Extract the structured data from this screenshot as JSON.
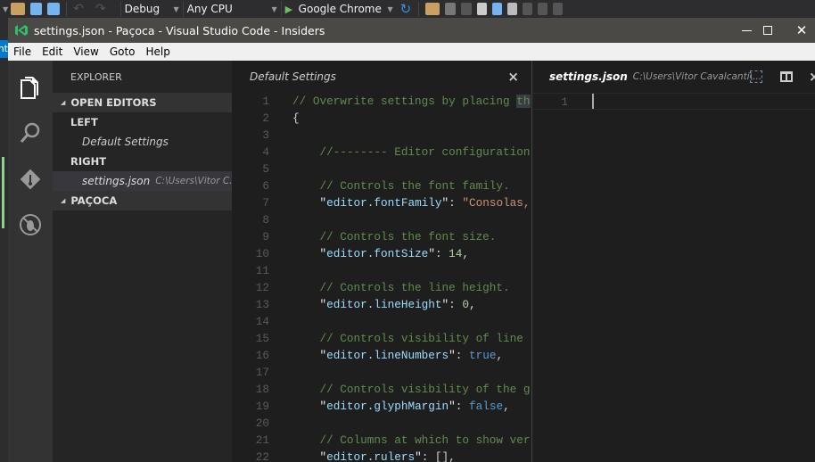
{
  "vs_toolbar": {
    "config": "Debug",
    "platform": "Any CPU",
    "run_target": "Google Chrome",
    "left_fragment": "nt"
  },
  "window": {
    "title": "settings.json - Paçoca - Visual Studio Code - Insiders",
    "minimize": "—",
    "maximize": "☐",
    "close": "✕"
  },
  "menu": [
    "File",
    "Edit",
    "View",
    "Goto",
    "Help"
  ],
  "sidebar": {
    "title": "EXPLORER",
    "open_editors": "OPEN EDITORS",
    "left_group": "LEFT",
    "left_file": "Default Settings",
    "right_group": "RIGHT",
    "right_file": "settings.json",
    "right_path": "C:\\Users\\Vitor C...",
    "folder": "PAÇOCA"
  },
  "left_editor": {
    "tab": "Default Settings",
    "close": "×",
    "lines": [
      [
        [
          "comment",
          "// Overwrite settings by placing "
        ],
        [
          "hl",
          "th"
        ]
      ],
      [
        [
          "punct",
          "{"
        ]
      ],
      [],
      [
        [
          "comment",
          "    //-------- Editor configuration"
        ]
      ],
      [],
      [
        [
          "comment",
          "    // Controls the font family."
        ]
      ],
      [
        [
          "punct",
          "    "
        ],
        [
          "quote",
          "\""
        ],
        [
          "key",
          "editor.fontFamily"
        ],
        [
          "quote",
          "\""
        ],
        [
          "punct",
          ": "
        ],
        [
          "string",
          "\"Consolas,"
        ]
      ],
      [],
      [
        [
          "comment",
          "    // Controls the font size."
        ]
      ],
      [
        [
          "punct",
          "    "
        ],
        [
          "quote",
          "\""
        ],
        [
          "key",
          "editor.fontSize"
        ],
        [
          "quote",
          "\""
        ],
        [
          "punct",
          ": "
        ],
        [
          "number",
          "14"
        ],
        [
          "punct",
          ","
        ]
      ],
      [],
      [
        [
          "comment",
          "    // Controls the line height."
        ]
      ],
      [
        [
          "punct",
          "    "
        ],
        [
          "quote",
          "\""
        ],
        [
          "key",
          "editor.lineHeight"
        ],
        [
          "quote",
          "\""
        ],
        [
          "punct",
          ": "
        ],
        [
          "number",
          "0"
        ],
        [
          "punct",
          ","
        ]
      ],
      [],
      [
        [
          "comment",
          "    // Controls visibility of line"
        ]
      ],
      [
        [
          "punct",
          "    "
        ],
        [
          "quote",
          "\""
        ],
        [
          "key",
          "editor.lineNumbers"
        ],
        [
          "quote",
          "\""
        ],
        [
          "punct",
          ": "
        ],
        [
          "bool",
          "true"
        ],
        [
          "punct",
          ","
        ]
      ],
      [],
      [
        [
          "comment",
          "    // Controls visibility of the g"
        ]
      ],
      [
        [
          "punct",
          "    "
        ],
        [
          "quote",
          "\""
        ],
        [
          "key",
          "editor.glyphMargin"
        ],
        [
          "quote",
          "\""
        ],
        [
          "punct",
          ": "
        ],
        [
          "bool",
          "false"
        ],
        [
          "punct",
          ","
        ]
      ],
      [],
      [
        [
          "comment",
          "    // Columns at which to show ver"
        ]
      ],
      [
        [
          "punct",
          "    "
        ],
        [
          "quote",
          "\""
        ],
        [
          "key",
          "editor.rulers"
        ],
        [
          "quote",
          "\""
        ],
        [
          "punct",
          ": [],"
        ]
      ]
    ]
  },
  "right_editor": {
    "tab": "settings.json",
    "path": "C:\\Users\\Vitor Cavalcanti\\...",
    "close": "×",
    "line_number": "1"
  }
}
